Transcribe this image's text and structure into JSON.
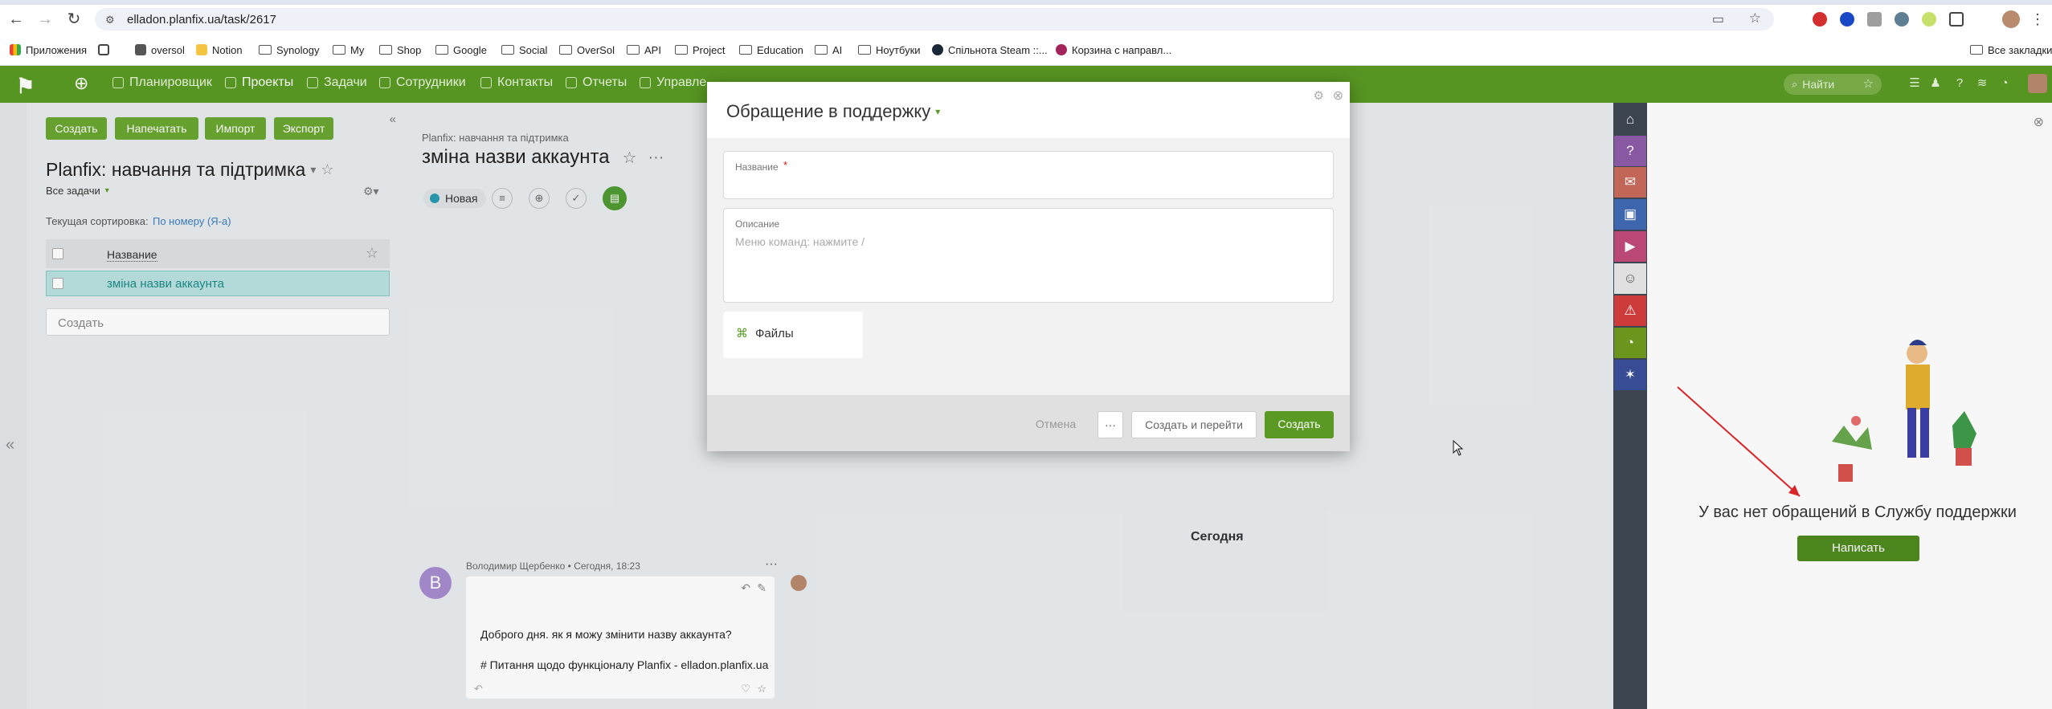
{
  "browser": {
    "url": "elladon.planfix.ua/task/2617",
    "bookmarks": [
      {
        "label": "Приложения",
        "type": "apps"
      },
      {
        "label": "",
        "type": "grid"
      },
      {
        "label": "oversol",
        "type": "site"
      },
      {
        "label": "Notion",
        "type": "site"
      },
      {
        "label": "Synology",
        "type": "folder"
      },
      {
        "label": "My",
        "type": "folder"
      },
      {
        "label": "Shop",
        "type": "folder"
      },
      {
        "label": "Google",
        "type": "folder"
      },
      {
        "label": "Social",
        "type": "folder"
      },
      {
        "label": "OverSol",
        "type": "folder"
      },
      {
        "label": "API",
        "type": "folder"
      },
      {
        "label": "Project",
        "type": "folder"
      },
      {
        "label": "Education",
        "type": "folder"
      },
      {
        "label": "AI",
        "type": "folder"
      },
      {
        "label": "Ноутбуки",
        "type": "folder"
      },
      {
        "label": "Спільнота Steam ::...",
        "type": "site"
      },
      {
        "label": "Корзина с направл...",
        "type": "site"
      }
    ],
    "all_bookmarks": "Все закладки"
  },
  "app": {
    "accent": "#5a9a24",
    "nav": [
      "Планировщик",
      "Проекты",
      "Задачи",
      "Сотрудники",
      "Контакты",
      "Отчеты",
      "Управле"
    ],
    "search_label": "Найти"
  },
  "left": {
    "buttons": [
      "Создать",
      "Напечатать",
      "Импорт",
      "Экспорт"
    ],
    "project_title": "Planfix: навчання та підтримка",
    "filter": "Все задачи",
    "sort_label": "Текущая сортировка:",
    "sort_value": "По номеру (Я-а)",
    "column": "Название",
    "task": "зміна назви аккаунта",
    "create_placeholder": "Создать"
  },
  "task": {
    "breadcrumb": "Planfix: навчання та підтримка",
    "title": "зміна назви аккаунта",
    "status": "Новая",
    "today": "Сегодня",
    "avatar_letter": "В",
    "author_meta": "Володимир Щербенко • Сегодня, 18:23",
    "message_line1": "Доброго дня. як я можу змінити назву аккаунта?",
    "message_line2": "# Питання щодо функціоналу Planfix - elladon.planfix.ua"
  },
  "modal": {
    "title": "Обращение в поддержку",
    "name_label": "Название",
    "required_mark": "*",
    "desc_label": "Описание",
    "desc_placeholder": "Меню команд: нажмите /",
    "files_label": "Файлы",
    "cancel": "Отмена",
    "more": "···",
    "create_go": "Создать и перейти",
    "create": "Создать"
  },
  "support": {
    "empty_text": "У вас нет обращений в Службу поддержки",
    "write_button": "Написать"
  }
}
